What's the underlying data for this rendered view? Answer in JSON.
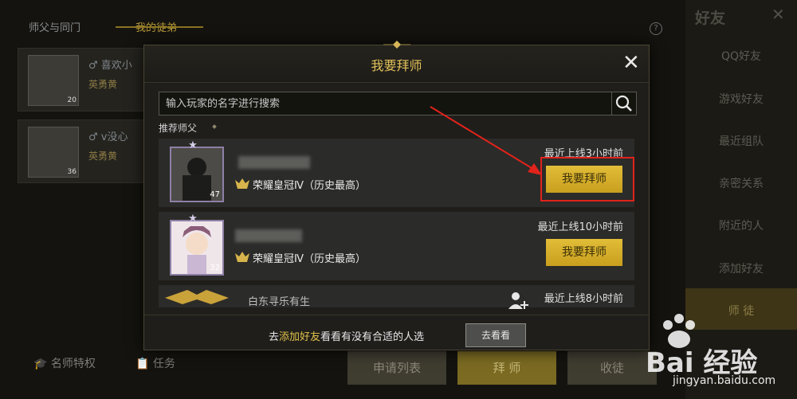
{
  "background": {
    "tabs": [
      "师父与同门",
      "我的徒弟"
    ],
    "cards": [
      {
        "name": "♂ 喜欢小",
        "rank": "英勇黄",
        "level": "20"
      },
      {
        "name": "♂ v没心",
        "rank": "英勇黄",
        "level": "36"
      }
    ],
    "bottom_items": [
      "名师特权",
      "任务"
    ],
    "bottom_buttons": [
      "申请列表",
      "拜 师",
      "收徒"
    ]
  },
  "sidebar": {
    "title": "好友",
    "items": [
      "QQ好友",
      "游戏好友",
      "最近组队",
      "亲密关系",
      "附近的人",
      "添加好友",
      "师 徒"
    ]
  },
  "modal": {
    "title": "我要拜师",
    "search_placeholder": "输入玩家的名字进行搜索",
    "recommend_label": "推荐师父",
    "rows": [
      {
        "level": "47",
        "rank": "荣耀皇冠Ⅳ（历史最高）",
        "online": "最近上线3小时前",
        "button": "我要拜师"
      },
      {
        "level": "32",
        "rank": "荣耀皇冠Ⅳ（历史最高）",
        "online": "最近上线10小时前",
        "button": "我要拜师"
      },
      {
        "name": "白东寻乐有生",
        "online": "最近上线8小时前"
      }
    ],
    "bottom_prefix": "去",
    "bottom_link": "添加好友",
    "bottom_suffix": "看看有没有合适的人选",
    "look_button": "去看看"
  },
  "watermark": {
    "text": "Bai  经验",
    "url": "jingyan.baidu.com"
  },
  "colors": {
    "gold": "#e1bd38",
    "highlight": "#e1231b",
    "title": "#e2c15a"
  }
}
